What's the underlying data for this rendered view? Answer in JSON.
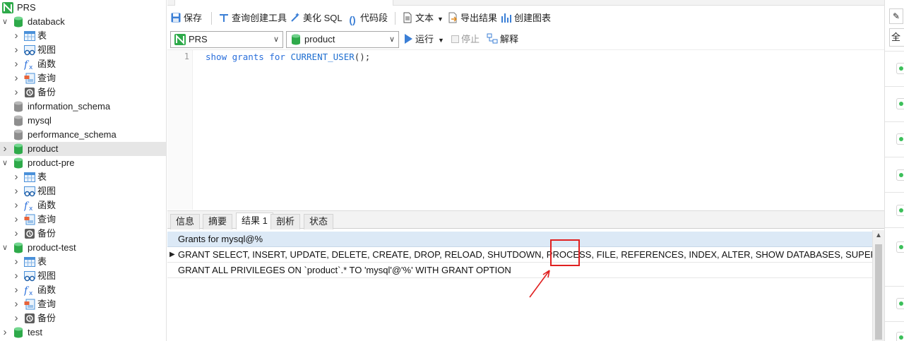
{
  "sidebar": {
    "rows": [
      {
        "label": "PRS",
        "icon": "connection-icon",
        "level": 0,
        "chevron": "",
        "selected": false
      },
      {
        "label": "databack",
        "icon": "database-green-icon",
        "level": 0,
        "chevron": "v",
        "selected": false
      },
      {
        "label": "表",
        "icon": "table-icon",
        "level": 1,
        "chevron": ">",
        "selected": false
      },
      {
        "label": "视图",
        "icon": "view-icon",
        "level": 1,
        "chevron": ">",
        "selected": false
      },
      {
        "label": "函数",
        "icon": "function-icon",
        "level": 1,
        "chevron": ">",
        "selected": false
      },
      {
        "label": "查询",
        "icon": "query-icon",
        "level": 1,
        "chevron": ">",
        "selected": false
      },
      {
        "label": "备份",
        "icon": "backup-icon",
        "level": 1,
        "chevron": ">",
        "selected": false
      },
      {
        "label": "information_schema",
        "icon": "database-gray-icon",
        "level": 0,
        "chevron": "",
        "selected": false
      },
      {
        "label": "mysql",
        "icon": "database-gray-icon",
        "level": 0,
        "chevron": "",
        "selected": false
      },
      {
        "label": "performance_schema",
        "icon": "database-gray-icon",
        "level": 0,
        "chevron": "",
        "selected": false
      },
      {
        "label": "product",
        "icon": "database-green-icon",
        "level": 0,
        "chevron": ">",
        "selected": true
      },
      {
        "label": "product-pre",
        "icon": "database-green-icon",
        "level": 0,
        "chevron": "v",
        "selected": false
      },
      {
        "label": "表",
        "icon": "table-icon",
        "level": 1,
        "chevron": ">",
        "selected": false
      },
      {
        "label": "视图",
        "icon": "view-icon",
        "level": 1,
        "chevron": ">",
        "selected": false
      },
      {
        "label": "函数",
        "icon": "function-icon",
        "level": 1,
        "chevron": ">",
        "selected": false
      },
      {
        "label": "查询",
        "icon": "query-icon",
        "level": 1,
        "chevron": ">",
        "selected": false
      },
      {
        "label": "备份",
        "icon": "backup-icon",
        "level": 1,
        "chevron": ">",
        "selected": false
      },
      {
        "label": "product-test",
        "icon": "database-green-icon",
        "level": 0,
        "chevron": "v",
        "selected": false
      },
      {
        "label": "表",
        "icon": "table-icon",
        "level": 1,
        "chevron": ">",
        "selected": false
      },
      {
        "label": "视图",
        "icon": "view-icon",
        "level": 1,
        "chevron": ">",
        "selected": false
      },
      {
        "label": "函数",
        "icon": "function-icon",
        "level": 1,
        "chevron": ">",
        "selected": false
      },
      {
        "label": "查询",
        "icon": "query-icon",
        "level": 1,
        "chevron": ">",
        "selected": false
      },
      {
        "label": "备份",
        "icon": "backup-icon",
        "level": 1,
        "chevron": ">",
        "selected": false
      },
      {
        "label": "test",
        "icon": "database-green-icon",
        "level": 0,
        "chevron": ">",
        "selected": false
      }
    ]
  },
  "toolbar": {
    "save": "保存",
    "query_builder": "查询创建工具",
    "beautify_sql": "美化 SQL",
    "code_snippet": "代码段",
    "text": "文本",
    "export_result": "导出结果",
    "create_chart": "创建图表"
  },
  "selectors": {
    "connection": "PRS",
    "database": "product",
    "run": "运行",
    "stop": "停止",
    "explain": "解释"
  },
  "editor": {
    "line_number": "1",
    "tokens": [
      {
        "text": "show",
        "kind": "kw"
      },
      {
        "text": " ",
        "kind": "pn"
      },
      {
        "text": "grants",
        "kind": "kw"
      },
      {
        "text": " ",
        "kind": "pn"
      },
      {
        "text": "for",
        "kind": "kw"
      },
      {
        "text": " ",
        "kind": "pn"
      },
      {
        "text": "CURRENT_USER",
        "kind": "fn"
      },
      {
        "text": "();",
        "kind": "pn"
      }
    ]
  },
  "result_tabs": [
    "信息",
    "摘要",
    "结果 1",
    "剖析",
    "状态"
  ],
  "result_active_tab": 2,
  "grid": {
    "header": "Grants for mysql@%",
    "rows": [
      "GRANT SELECT, INSERT, UPDATE, DELETE, CREATE, DROP, RELOAD, SHUTDOWN, PROCESS, FILE, REFERENCES, INDEX, ALTER, SHOW DATABASES, SUPER, CREATE TEMP",
      "GRANT ALL PRIVILEGES ON `product`.* TO 'mysql'@'%' WITH GRANT OPTION"
    ],
    "current_row_marker": "▶"
  },
  "right_pane": {
    "field_text": "全部"
  },
  "colors": {
    "accent_green": "#2eaa4a",
    "keyword_blue": "#2a6fdb",
    "header_blue": "#dce9f6",
    "highlight_red": "#e02020"
  }
}
